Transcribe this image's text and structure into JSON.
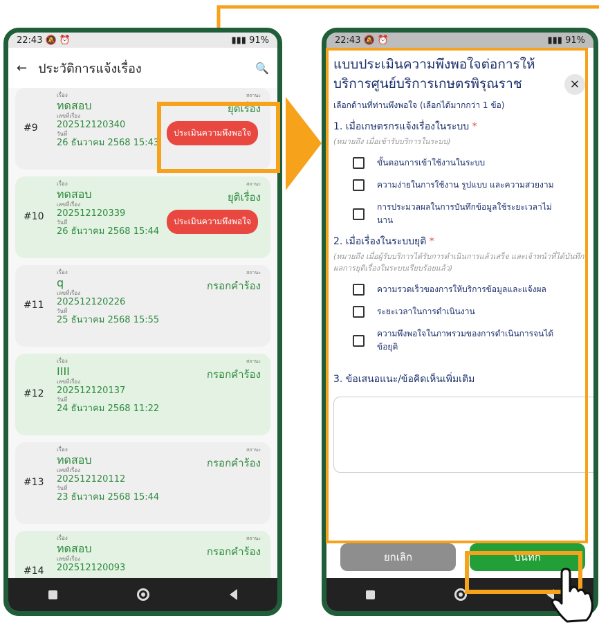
{
  "left_phone": {
    "status_time": "22:43",
    "status_icons": "🔕 ⏰",
    "status_right": "▮▮▮ 91%",
    "title": "ประวัติการแจ้งเรื่อง",
    "back_icon": "←",
    "search_icon": "🔍",
    "labels": {
      "subject": "เรื่อง",
      "ref": "เลขที่เรื่อง",
      "date": "วันที่",
      "status": "สถานะ"
    },
    "eval_button_label": "ประเมินความพึงพอใจ",
    "cards": [
      {
        "num": "#9",
        "subject": "ทดสอบ",
        "ref": "202512120340",
        "date": "26 ธันวาคม 2568 15:43",
        "status": "ยุติเรื่อง",
        "green": false,
        "eval": true
      },
      {
        "num": "#10",
        "subject": "ทดสอบ",
        "ref": "202512120339",
        "date": "26 ธันวาคม 2568 15:44",
        "status": "ยุติเรื่อง",
        "green": true,
        "eval": true
      },
      {
        "num": "#11",
        "subject": "q",
        "ref": "202512120226",
        "date": "25 ธันวาคม 2568 15:55",
        "status": "กรอกคำร้อง",
        "green": false,
        "eval": false
      },
      {
        "num": "#12",
        "subject": "IIII",
        "ref": "202512120137",
        "date": "24 ธันวาคม 2568 11:22",
        "status": "กรอกคำร้อง",
        "green": true,
        "eval": false
      },
      {
        "num": "#13",
        "subject": "ทดสอบ",
        "ref": "202512120112",
        "date": "23 ธันวาคม 2568 15:44",
        "status": "กรอกคำร้อง",
        "green": false,
        "eval": false
      },
      {
        "num": "#14",
        "subject": "ทดสอบ",
        "ref": "202512120093",
        "date": "",
        "status": "กรอกคำร้อง",
        "green": true,
        "eval": false
      }
    ]
  },
  "right_phone": {
    "status_time": "22:43",
    "status_icons": "🔕 ⏰",
    "status_right": "▮▮▮ 91%",
    "form_title": "แบบประเมินความพึงพอใจต่อการให้บริการศูนย์บริการเกษตรพิรุณราช",
    "close_icon": "×",
    "hint": "เลือกด้านที่ท่านพึงพอใจ (เลือกได้มากกว่า 1 ข้อ)",
    "q1": "1. เมื่อเกษตรกรแจ้งเรื่องในระบบ",
    "q1_note": "(หมายถึง เมื่อเข้ารับบริการในระบบ)",
    "q1_options": [
      "ขั้นตอนการเข้าใช้งานในระบบ",
      "ความง่ายในการใช้งาน รูปแบบ และความสวยงาม",
      "การประมวลผลในการบันทึกข้อมูลใช้ระยะเวลาไม่นาน"
    ],
    "q2": "2. เมื่อเรื่องในระบบยุติ",
    "q2_note": "(หมายถึง เมื่อผู้รับบริการได้รับการดำเนินการแล้วเสร็จ และเจ้าหน้าที่ได้บันทึกผลการยุติเรื่องในระบบเรียบร้อยแล้ว)",
    "q2_options": [
      "ความรวดเร็วของการให้บริการข้อมูลและแจ้งผล",
      "ระยะเวลาในการดำเนินงาน",
      "ความพึงพอใจในภาพรวมของการดำเนินการจนได้ข้อยุติ"
    ],
    "required_mark": "*",
    "q3": "3. ข้อเสนอแนะ/ข้อคิดเห็นเพิ่มเติม",
    "cancel_label": "ยกเลิก",
    "save_label": "บันทึก"
  },
  "colors": {
    "highlight": "#f7a21b",
    "phone_frame": "#1f5e38",
    "eval_red": "#e84840",
    "save_green": "#22a037",
    "title_navy": "#1b2f6b",
    "status_green": "#2e8b3d"
  }
}
